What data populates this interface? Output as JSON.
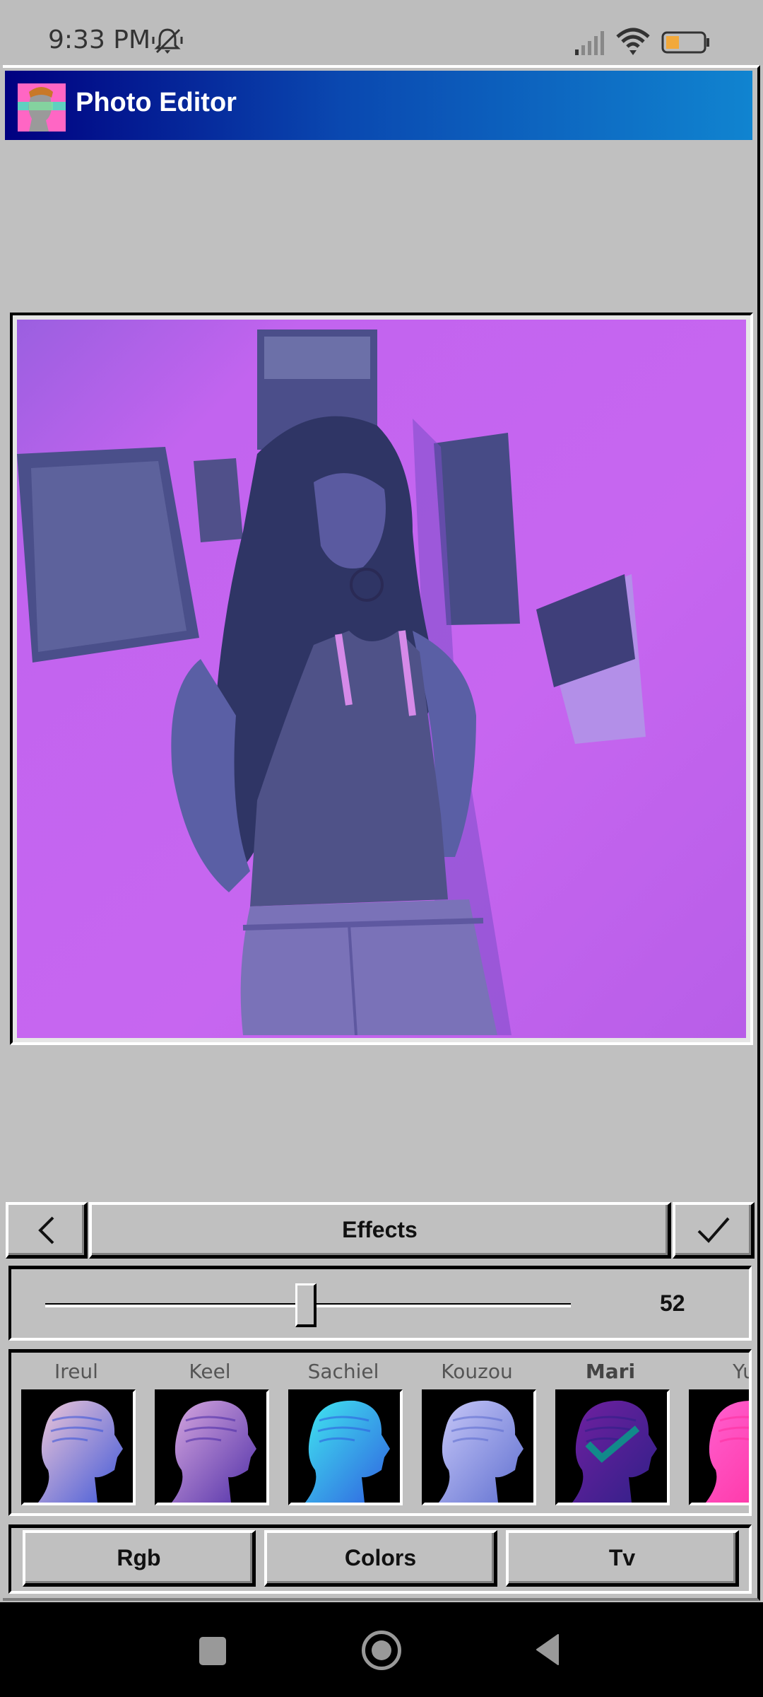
{
  "status_bar": {
    "time": "9:33 PM",
    "icons": [
      "mute-icon",
      "signal-icon",
      "wifi-icon",
      "battery-icon"
    ],
    "battery_color": "#f2a93b"
  },
  "app": {
    "title": "Photo Editor",
    "logo": "statue-logo",
    "title_bar_gradient": [
      "#000080",
      "#1084d0"
    ]
  },
  "photo": {
    "description": "Purple-tinted photo of a long-haired woman leaning against a wall with pinned photos",
    "tint_color": "#c766f0"
  },
  "toolbar": {
    "back_icon": "chevron-left-icon",
    "title": "Effects",
    "confirm_icon": "checkmark-icon"
  },
  "slider": {
    "value": "52",
    "fraction": 0.52
  },
  "effects": {
    "items": [
      {
        "label": "Ireul",
        "tint": [
          "#f0c8d8",
          "#4058d8"
        ],
        "selected": false
      },
      {
        "label": "Keel",
        "tint": [
          "#d8a8e0",
          "#5030a8"
        ],
        "selected": false
      },
      {
        "label": "Sachiel",
        "tint": [
          "#40e8f0",
          "#3060e0"
        ],
        "selected": false
      },
      {
        "label": "Kouzou",
        "tint": [
          "#c8c8f8",
          "#6070d0"
        ],
        "selected": false
      },
      {
        "label": "Mari",
        "tint": [
          "#7020a0",
          "#302088"
        ],
        "selected": true
      },
      {
        "label": "Yu",
        "tint": [
          "#ff60d0",
          "#ff30a0"
        ],
        "selected": false
      }
    ],
    "check_color": "#128a8a"
  },
  "categories": {
    "items": [
      "Rgb",
      "Colors",
      "Tv"
    ]
  },
  "nav_bar": {
    "icons": [
      "recents-icon",
      "home-icon",
      "back-icon"
    ]
  }
}
